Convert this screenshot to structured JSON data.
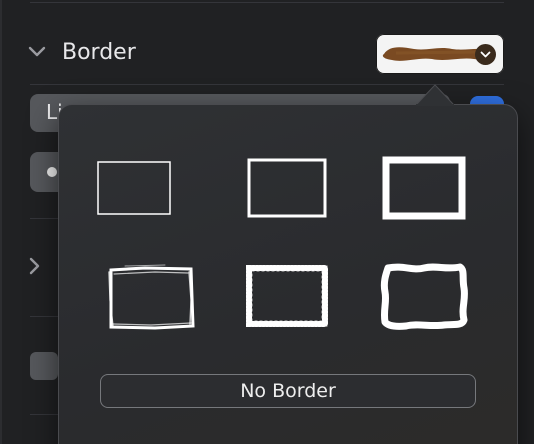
{
  "sidebar": {
    "section_title": "Border",
    "section_chevron_icon": "chevron-down-icon",
    "line_style_select_text": "Li",
    "collapsed_chevron_icon": "chevron-right-icon"
  },
  "border_swatch": {
    "stroke_color": "#7a4a22",
    "dropdown_icon": "chevron-down-icon"
  },
  "popover": {
    "border_styles": [
      {
        "name": "thin-line",
        "stroke": 1.5
      },
      {
        "name": "medium-line",
        "stroke": 3
      },
      {
        "name": "thick-line",
        "stroke": 7
      },
      {
        "name": "rough-pencil",
        "stroke": 3
      },
      {
        "name": "chalk",
        "stroke": 5
      },
      {
        "name": "wavy-brush",
        "stroke": 7
      }
    ],
    "no_border_label": "No Border"
  },
  "colors": {
    "accent_blue": "#2f6fe0",
    "popover_border": "#4a4b4f",
    "frame_white": "#ffffff"
  }
}
